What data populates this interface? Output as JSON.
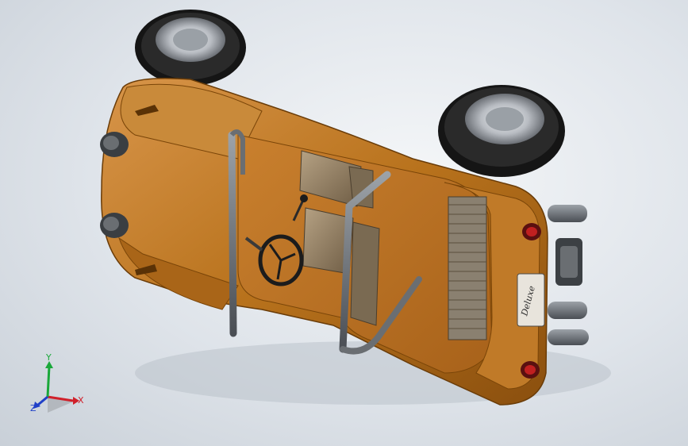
{
  "model": {
    "plate_text": "Deluxe"
  },
  "triad": {
    "x_label": "X",
    "y_label": "Y",
    "z_label": "Z"
  },
  "colors": {
    "body": "#b8721c",
    "body_dark": "#7a4508",
    "body_light": "#e0a04a",
    "tire": "#1c1c1c",
    "rim": "#c8ccd0",
    "rollbar": "#5a5e62",
    "seat": "#8e7a5e",
    "background": "#e4e8ec",
    "axis_x": "#d0202a",
    "axis_y": "#1aa83a",
    "axis_z": "#2040c8"
  }
}
